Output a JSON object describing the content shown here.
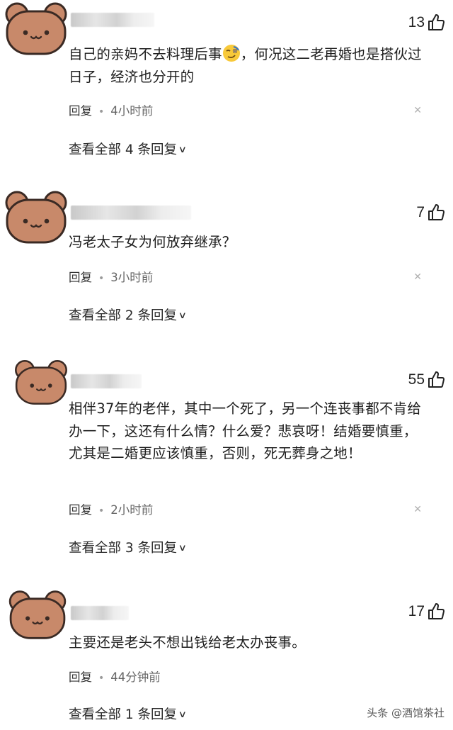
{
  "comments": [
    {
      "text": "自己的亲妈不去料理后事",
      "text_after_emoji": "，何况这二老再婚也是搭伙过日子，经济也分开的",
      "has_emoji": true,
      "emoji_icon": "wink-smirk-emoji",
      "likes": "13",
      "reply_label": "回复",
      "time": "4小时前",
      "view_replies": "查看全部 4 条回复"
    },
    {
      "text": "冯老太子女为何放弃继承？",
      "likes": "7",
      "reply_label": "回复",
      "time": "3小时前",
      "view_replies": "查看全部 2 条回复"
    },
    {
      "text": "相伴37年的老伴，其中一个死了，另一个连丧事都不肯给办一下，这还有什么情？什么爱？悲哀呀！结婚要慎重，尤其是二婚更应该慎重，否则，死无葬身之地！",
      "likes": "55",
      "reply_label": "回复",
      "time": "2小时前",
      "view_replies": "查看全部 3 条回复"
    },
    {
      "text": "主要还是老头不想出钱给老太办丧事。",
      "likes": "17",
      "reply_label": "回复",
      "time": "44分钟前",
      "view_replies": "查看全部 1 条回复"
    }
  ],
  "icons": {
    "avatar": "bear-face-avatar",
    "like": "thumbs-up-icon",
    "close": "close-x-icon",
    "expand": "chevron-down-icon"
  },
  "colors": {
    "avatar_fill": "#c8896a",
    "avatar_outline": "#3a2a24",
    "text": "#1e1e1e",
    "meta": "#666666"
  },
  "watermark": "头条 @酒馆茶社"
}
